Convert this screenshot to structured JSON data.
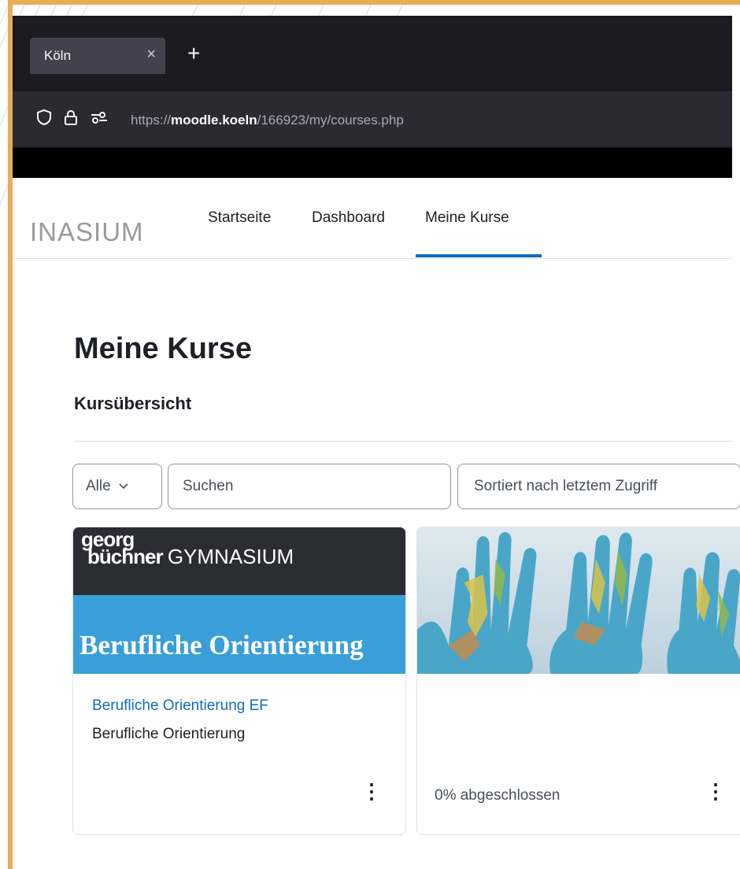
{
  "browser": {
    "tab_title": "Köln",
    "tab_close": "×",
    "new_tab": "+",
    "url_prefix": "https://",
    "url_host": "moodle.koeln",
    "url_path": "/166923/my/courses.php"
  },
  "site": {
    "logo_text": "INASIUM"
  },
  "nav": {
    "items": [
      {
        "label": "Startseite"
      },
      {
        "label": "Dashboard"
      },
      {
        "label": "Meine Kurse"
      }
    ]
  },
  "page": {
    "title": "Meine Kurse",
    "section": "Kursübersicht"
  },
  "controls": {
    "filter_value": "Alle",
    "search_placeholder": "Suchen",
    "sort_value": "Sortiert nach letztem Zugriff"
  },
  "courses": [
    {
      "banner_logo_line1": "georg",
      "banner_logo_line2": "büchner",
      "banner_logo_gym": "GYMNASIUM",
      "banner_title": "Berufliche Orientierung",
      "name": "Berufliche Orientierung EF",
      "category": "Berufliche Orientierung",
      "menu": "⋮"
    },
    {
      "image_desc": "world-map-hands-image",
      "progress": "0% abgeschlossen",
      "progress_value": 0,
      "menu": "⋮"
    }
  ],
  "colors": {
    "accent": "#0f6cbf",
    "frame": "#e6ad56",
    "banner_blue": "#3a9fd9",
    "banner_dark": "#2c2c34"
  }
}
